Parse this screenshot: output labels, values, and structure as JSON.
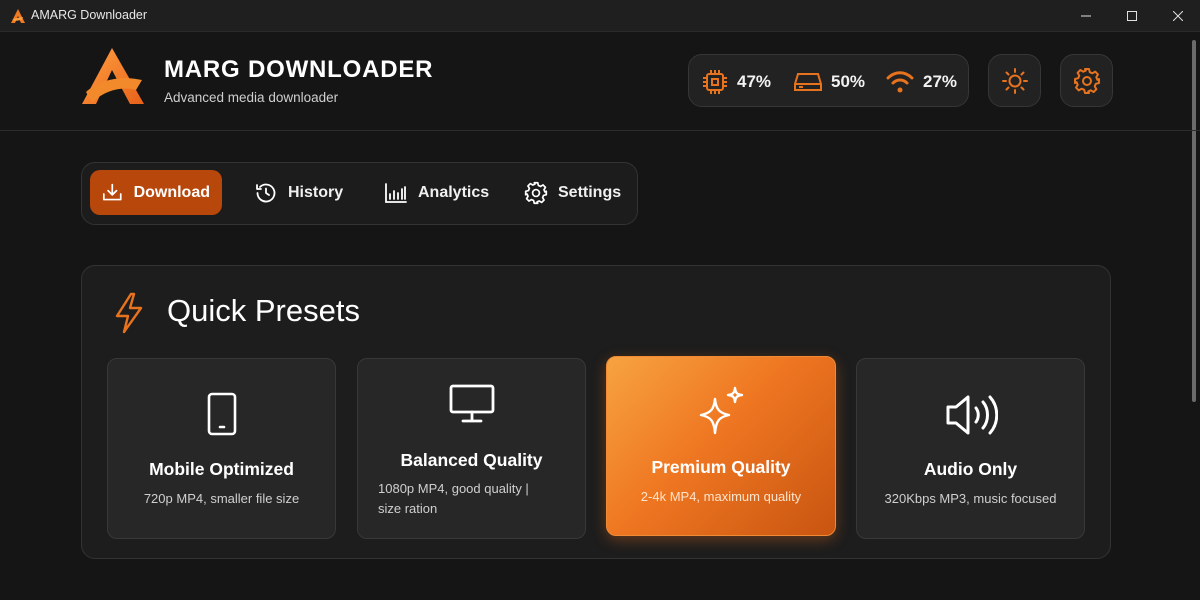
{
  "window": {
    "title": "AMARG Downloader",
    "controls": [
      "minimize",
      "maximize",
      "close"
    ]
  },
  "header": {
    "brand_title": "MARG DOWNLOADER",
    "brand_subtitle": "Advanced media downloader",
    "stats": {
      "cpu": {
        "icon": "cpu-icon",
        "value": "47%"
      },
      "disk": {
        "icon": "disk-icon",
        "value": "50%"
      },
      "network": {
        "icon": "wifi-icon",
        "value": "27%"
      }
    },
    "theme_button_icon": "sun-icon",
    "settings_button_icon": "gear-icon"
  },
  "nav": {
    "tabs": [
      {
        "label": "Download",
        "icon": "download-icon",
        "active": true
      },
      {
        "label": "History",
        "icon": "history-icon",
        "active": false
      },
      {
        "label": "Analytics",
        "icon": "bar-chart-icon",
        "active": false
      },
      {
        "label": "Settings",
        "icon": "gear-icon",
        "active": false
      }
    ]
  },
  "presets": {
    "title": "Quick Presets",
    "title_icon": "lightning-icon",
    "cards": [
      {
        "name": "Mobile Optimized",
        "desc": "720p MP4, smaller file size",
        "icon": "phone-icon",
        "selected": false
      },
      {
        "name": "Balanced Quality",
        "desc": "1080p MP4, good quality | size ration",
        "icon": "monitor-icon",
        "selected": false
      },
      {
        "name": "Premium Quality",
        "desc": "2-4k MP4, maximum quality",
        "icon": "sparkles-icon",
        "selected": true
      },
      {
        "name": "Audio Only",
        "desc": "320Kbps MP3, music focused",
        "icon": "speaker-icon",
        "selected": false
      }
    ]
  },
  "colors": {
    "accent": "#e8731f",
    "accent_dark": "#b8470c",
    "background": "#151515",
    "panel": "#1d1d1d",
    "card": "#272727"
  }
}
